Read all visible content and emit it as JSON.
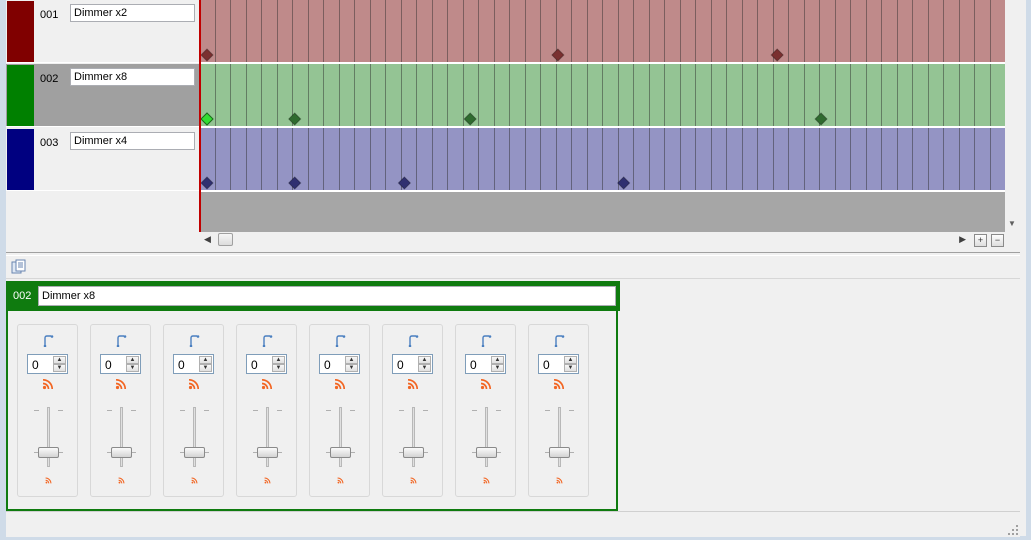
{
  "tracks": [
    {
      "number": "001",
      "name": "Dimmer x2",
      "color": "#800000",
      "lane_color": "#bf8a8a",
      "marker_color": "#7a3030",
      "selected": false,
      "marker_positions": [
        0,
        8,
        13
      ]
    },
    {
      "number": "002",
      "name": "Dimmer x8",
      "color": "#008000",
      "lane_color": "#94c494",
      "marker_color": "#2f6b2f",
      "selected": true,
      "marker_positions": [
        0,
        2,
        6,
        14
      ],
      "highlight_marker_color": "#33dd33"
    },
    {
      "number": "003",
      "name": "Dimmer x4",
      "color": "#000080",
      "lane_color": "#9494c4",
      "marker_color": "#303070",
      "selected": false,
      "marker_positions": [
        0,
        2,
        4.5,
        9.5
      ]
    }
  ],
  "timeline": {
    "cursor_color": "#c00000",
    "zoom_in_icon": "zoom-in-icon",
    "zoom_out_icon": "zoom-out-icon"
  },
  "selected_track": {
    "number": "002",
    "name": "Dimmer x8",
    "header_color": "#0f7b0f"
  },
  "channels": [
    {
      "value": "0"
    },
    {
      "value": "0"
    },
    {
      "value": "0"
    },
    {
      "value": "0"
    },
    {
      "value": "0"
    },
    {
      "value": "0"
    },
    {
      "value": "0"
    },
    {
      "value": "0"
    }
  ],
  "icons": {
    "toolbar": "properties-icon",
    "channel_top": "curve-icon",
    "channel_mid": "rss-icon",
    "channel_bottom": "rss-icon"
  }
}
